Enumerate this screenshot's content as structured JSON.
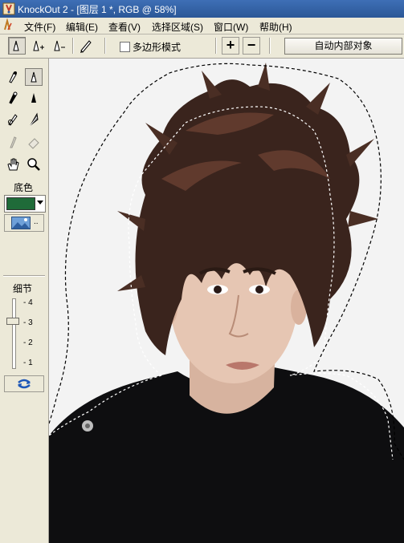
{
  "window": {
    "title": "KnockOut 2 - [图层 1 *, RGB @ 58%]"
  },
  "menu": {
    "items": [
      {
        "label": "文件(F)"
      },
      {
        "label": "编辑(E)"
      },
      {
        "label": "查看(V)"
      },
      {
        "label": "选择区域(S)"
      },
      {
        "label": "窗口(W)"
      },
      {
        "label": "帮助(H)"
      }
    ]
  },
  "toolbar": {
    "polygon_mode_label": "多边形模式",
    "polygon_mode_checked": false,
    "plus_label": "+",
    "minus_label": "−",
    "auto_inner_object_label": "自动内部对象"
  },
  "tools": [
    {
      "icon": "inside-brush-icon"
    },
    {
      "icon": "inside-lasso-icon"
    },
    {
      "icon": "outside-brush-icon"
    },
    {
      "icon": "outside-lasso-icon"
    },
    {
      "icon": "detail-brush-icon"
    },
    {
      "icon": "feather-icon"
    },
    {
      "icon": "touchup-brush-icon"
    },
    {
      "icon": "eraser-icon"
    },
    {
      "icon": "hand-icon"
    },
    {
      "icon": "zoom-icon"
    }
  ],
  "background": {
    "label": "底色",
    "color": "#1f6b39"
  },
  "detail": {
    "label": "细节",
    "ticks": [
      "- 4",
      "- 3",
      "- 2",
      "- 1"
    ],
    "value": 3
  },
  "canvas": {
    "zoom": "58%"
  }
}
